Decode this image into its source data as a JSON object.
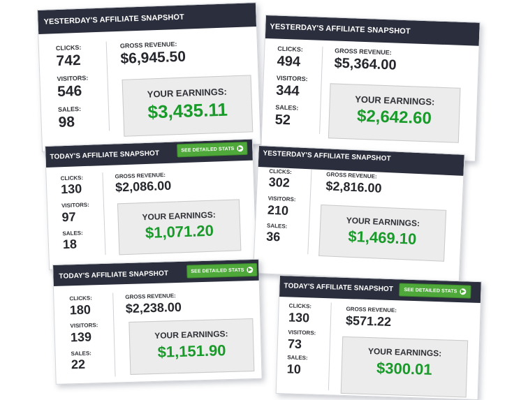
{
  "labels": {
    "clicks": "CLICKS:",
    "visitors": "VISITORS:",
    "sales": "SALES:",
    "gross_revenue": "GROSS REVENUE:",
    "your_earnings": "YOUR EARNINGS:"
  },
  "colors": {
    "header_bg": "#2b2e3c",
    "earnings_green": "#1a9a2a",
    "button_green": "#4fa83a"
  },
  "cards": [
    {
      "title": "YESTERDAY'S AFFILIATE SNAPSHOT",
      "clicks": "742",
      "visitors": "546",
      "sales": "98",
      "gross_revenue": "$6,945.50",
      "earnings": "$3,435.11"
    },
    {
      "title": "YESTERDAY'S AFFILIATE SNAPSHOT",
      "clicks": "494",
      "visitors": "344",
      "sales": "52",
      "gross_revenue": "$5,364.00",
      "earnings": "$2,642.60"
    },
    {
      "title": "TODAY'S AFFILIATE SNAPSHOT",
      "button": "SEE DETAILED STATS",
      "clicks": "130",
      "visitors": "97",
      "sales": "18",
      "gross_revenue": "$2,086.00",
      "earnings": "$1,071.20"
    },
    {
      "title": "YESTERDAY'S AFFILIATE SNAPSHOT",
      "clicks": "302",
      "visitors": "210",
      "sales": "36",
      "gross_revenue": "$2,816.00",
      "earnings": "$1,469.10"
    },
    {
      "title": "TODAY'S AFFILIATE SNAPSHOT",
      "button": "SEE DETAILED STATS",
      "clicks": "180",
      "visitors": "139",
      "sales": "22",
      "gross_revenue": "$2,238.00",
      "earnings": "$1,151.90"
    },
    {
      "title": "TODAY'S AFFILIATE SNAPSHOT",
      "button": "SEE DETAILED STATS",
      "clicks": "130",
      "visitors": "73",
      "sales": "10",
      "gross_revenue": "$571.22",
      "earnings": "$300.01"
    }
  ]
}
